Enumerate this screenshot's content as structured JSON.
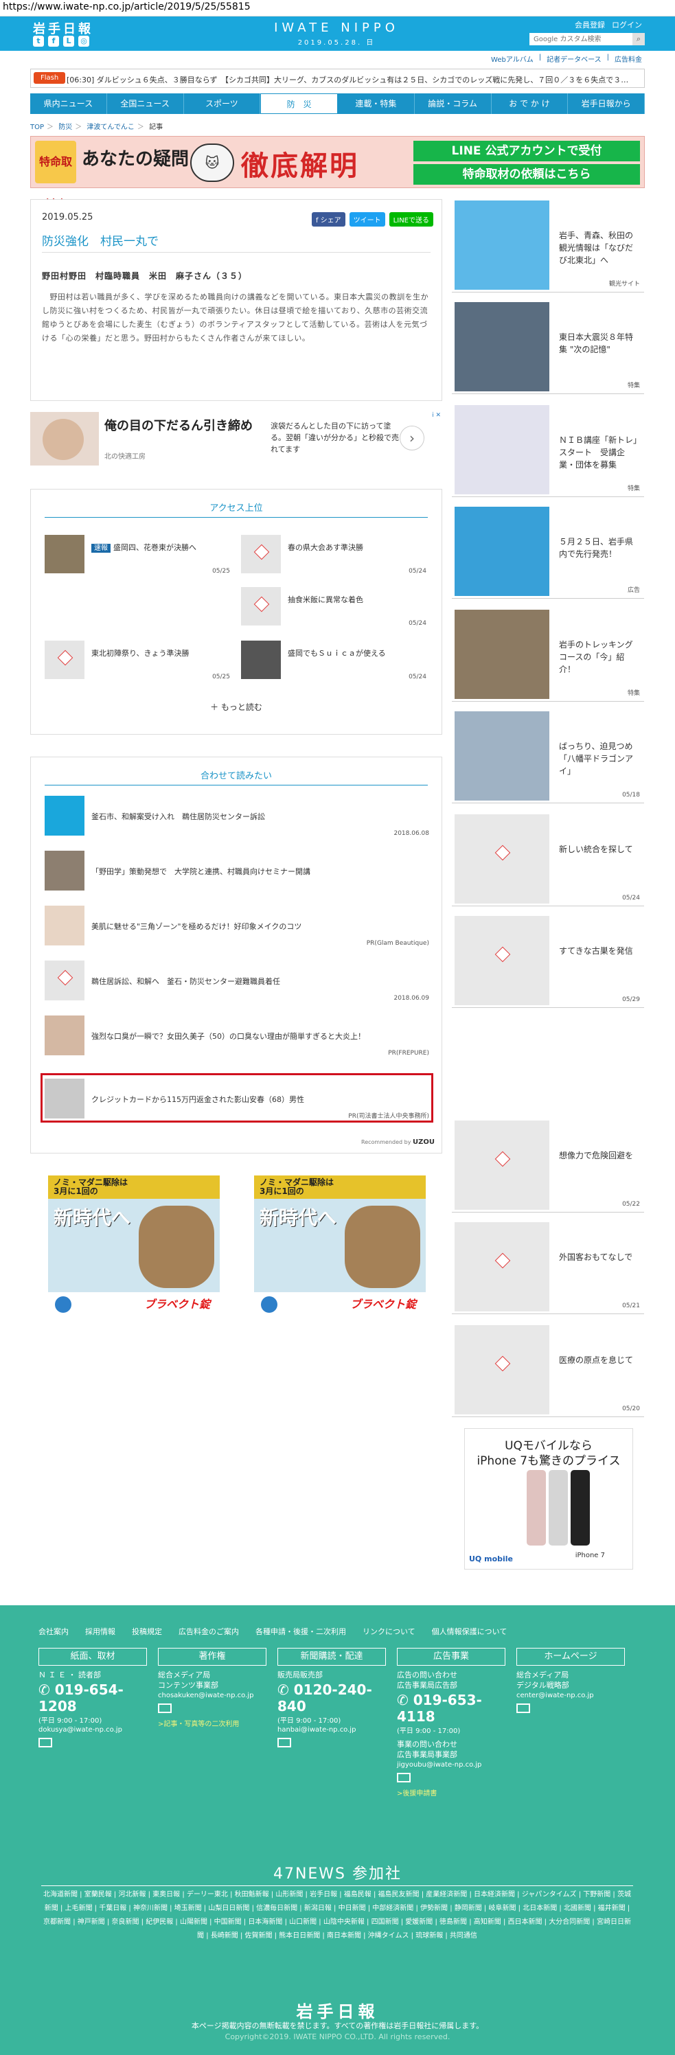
{
  "browser": {
    "url": "https://www.iwate-np.co.jp/article/2019/5/25/55815"
  },
  "header": {
    "logo": "岩手日報",
    "brand": "IWATE NIPPO",
    "date": "2019.05.28. 日",
    "member_register": "会員登録",
    "login": "ログイン",
    "search_placeholder": "Google カスタム検索",
    "subnav": [
      "Webアルバム",
      "記者データベース",
      "広告料金"
    ]
  },
  "flash": {
    "label": "Flash",
    "text": "[06:30] ダルビッシュ６失点、３勝目ならず　【シカゴ共同】大リーグ、カブスのダルビッシュ有は２５日、シカゴでのレッズ戦に先発し、７回０／３を６失点で３…"
  },
  "nav": {
    "items": [
      "県内ニュース",
      "全国ニュース",
      "スポーツ",
      "防　災",
      "連載・特集",
      "論説・コラム",
      "お で か け",
      "岩手日報から"
    ]
  },
  "breadcrumb": {
    "items": [
      "TOP",
      "防災",
      "津波てんでんこ",
      "記事"
    ]
  },
  "banner": {
    "tag": "特命取材班",
    "question": "あなたの疑問",
    "headline": "徹底解明",
    "line1": "LINE 公式アカウントで受付",
    "line2": "特命取材の依頼はこちら"
  },
  "article": {
    "date": "2019.05.25",
    "share": {
      "facebook": "f シェア",
      "twitter": "ツイート",
      "line": "LINEで送る"
    },
    "title": "防災強化　村民一丸で",
    "byline": "野田村野田　村臨時職員　米田　麻子さん（３５）",
    "body": "　野田村は若い職員が多く、学びを深めるため職員向けの講義などを開いている。東日本大震災の教訓を生かし防災に強い村をつくるため、村民皆が一丸で頑張りたい。休日は昼頃で絵を描いており、久慈市の芸術交流館ゆうとびあを会場にした麦生（むぎょう）のボランティアスタッフとして活動している。芸術は人を元気づける「心の栄養」だと思う。野田村からもたくさん作者さんが来てほしい。"
  },
  "ad1": {
    "headline": "俺の目の下だるん引き締め",
    "source": "北の快適工房",
    "desc": "涙袋だるんとした目の下に訪って塗る。翌朝「違いが分かる」と秒殺で売れてます",
    "ad_mark": "i ✕"
  },
  "ranking": {
    "title": "アクセス上位",
    "items": [
      {
        "tag": "速報",
        "title": "盛岡四、花巻東が決勝へ",
        "date": "05/25"
      },
      {
        "title": "春の県大会あす準決勝",
        "date": "05/24"
      },
      {
        "title": "抽食米飯に異常な着色",
        "date": "05/24"
      },
      {
        "title": "東北初陣祭り、きょう準決勝",
        "date": "05/25"
      },
      {
        "title": "盛岡でもＳｕｉｃａが使える",
        "date": "05/24"
      }
    ],
    "more": "もっと読む"
  },
  "recommended": {
    "title": "合わせて読みたい",
    "items": [
      {
        "title": "釜石市、和解案受け入れ　鵜住居防災センター訴訟",
        "date": "2018.06.08"
      },
      {
        "title": "「野田学」策動発想で　大学院と連携、村職員向けセミナー開講",
        "date": ""
      },
      {
        "title": "美肌に魅せる\"三角ゾーン\"を極めるだけ！好印象メイクのコツ",
        "date": "PR(Glam Beautique)"
      },
      {
        "title": "鵜住居訴訟、和解へ　釜石・防災センター避難職員着任",
        "date": "2018.06.09"
      },
      {
        "title": "強烈な口臭が一瞬で？女田久美子（50）の口臭ない理由が簡単すぎると大炎上！",
        "date": "PR(FREPURE)"
      },
      {
        "title": "クレジットカードから115万円返金された影山安春（68）男性",
        "date": "PR(司法書士法人中央事務所)"
      }
    ],
    "recommended_by": "Recommended by",
    "logo": "UZOU"
  },
  "bottom_ads": {
    "top_line1": "ノミ・マダニ駆除は",
    "top_line2": "3月に1回の",
    "main": "新時代へ",
    "brand": "ブラベクト錠"
  },
  "sidebar": {
    "items": [
      {
        "title": "岩手、青森、秋田の観光情報は「なびだび北東北」へ",
        "date": "観光サイト"
      },
      {
        "title": "東日本大震災８年特集 \"次の記憶\"",
        "date": "特集"
      },
      {
        "title": "ＮＩＢ講座「新トレ」スタート　受講企業・団体を募集",
        "date": "特集"
      },
      {
        "title": "５月２５日、岩手県内で先行発売！",
        "date": "広告"
      },
      {
        "title": "岩手のトレッキングコースの「今」紹介！",
        "date": "特集"
      },
      {
        "title": "ばっちり、迫見つめ「八幡平ドラゴンアイ」",
        "date": "05/18"
      },
      {
        "title": "新しい統合を探して",
        "date": "05/24"
      },
      {
        "title": "すてきな古巣を発信",
        "date": "05/29"
      },
      {
        "title": "想像力で危険回避を",
        "date": "05/22"
      },
      {
        "title": "外国客おもてなしで",
        "date": "05/21"
      },
      {
        "title": "医療の原点を息じて",
        "date": "05/20"
      }
    ]
  },
  "side_ad": {
    "line1": "UQモバイルなら",
    "line2": "iPhone 7も驚きのプライス",
    "logo": "UQ mobile",
    "model": "iPhone 7"
  },
  "footer": {
    "links": [
      "会社案内",
      "採用情報",
      "投稿規定",
      "広告料金のご案内",
      "各種申請・後援・二次利用",
      "リンクについて",
      "個人情報保護について"
    ],
    "columns": [
      {
        "head": "紙面、取材",
        "sub": "Ｎ Ｉ Ｅ ・ 読者部",
        "tel": "019-654-1208",
        "hours": "(平日 9:00 - 17:00)",
        "mail": "dokusya@iwate-np.co.jp"
      },
      {
        "head": "著作権",
        "sub": "総合メディア局\nコンテンツ事業部",
        "mail": "chosakuken@iwate-np.co.jp",
        "note": ">記事・写真等の二次利用"
      },
      {
        "head": "新聞購読・配達",
        "sub": "販売局販売部",
        "tel": "0120-240-840",
        "hours": "(平日 9:00 - 17:00)",
        "mail": "hanbai@iwate-np.co.jp"
      },
      {
        "head": "広告事業",
        "sub": "広告の問い合わせ\n広告事業局広告部",
        "tel": "019-653-4118",
        "hours": "(平日 9:00 - 17:00)",
        "sub2": "事業の問い合わせ\n広告事業局事業部",
        "mail": "jigyoubu@iwate-np.co.jp",
        "note": ">後援申請書"
      },
      {
        "head": "ホームページ",
        "sub": "総合メディア局\nデジタル戦略部",
        "mail": "center@iwate-np.co.jp"
      }
    ],
    "news_title": "47NEWS 参加社",
    "news_list": "北海道新聞 | 室蘭民報 | 河北新報 | 東奥日報 | デーリー東北 | 秋田魁新報 | 山形新聞 | 岩手日報 | 福島民報 | 福島民友新聞 | 産業経済新聞 | 日本経済新聞 | ジャパンタイムズ | 下野新聞 | 茨城新聞 | 上毛新聞 | 千葉日報 | 神奈川新聞 | 埼玉新聞 | 山梨日日新聞 | 信濃毎日新聞 | 新潟日報 | 中日新聞 | 中部経済新聞 | 伊勢新聞 | 静岡新聞 | 岐阜新聞 | 北日本新聞 | 北國新聞 | 福井新聞 | 京都新聞 | 神戸新聞 | 奈良新聞 | 紀伊民報 | 山陽新聞 | 中国新聞 | 日本海新聞 | 山口新聞 | 山陰中央新報 | 四国新聞 | 愛媛新聞 | 徳島新聞 | 高知新聞 | 西日本新聞 | 大分合同新聞 | 宮崎日日新聞 | 長崎新聞 | 佐賀新聞 | 熊本日日新聞 | 南日本新聞 | 沖縄タイムス | 琉球新報 | 共同通信",
    "logo": "岩手日報",
    "copy1": "本ページ掲載内容の無断転載を禁じます。すべての著作権は岩手日報社に帰属します。",
    "copy2": "Copyright©2019. IWATE NIPPO CO.,LTD. All rights reserved."
  }
}
